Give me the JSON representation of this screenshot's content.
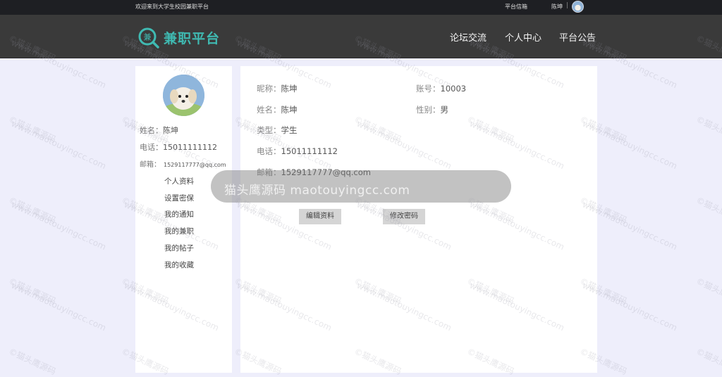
{
  "topbar": {
    "welcome": "欢迎来到大学生校园兼职平台",
    "mail": "平台信箱",
    "username": "陈坤",
    "separator": "|"
  },
  "navbar": {
    "logo_icon_char": "兼",
    "logo_text": "兼职平台",
    "items": [
      "论坛交流",
      "个人中心",
      "平台公告"
    ],
    "brand_color": "#3fbab2"
  },
  "sidebar": {
    "name_label": "姓名：",
    "name": "陈坤",
    "phone_label": "电话：",
    "phone": "15011111112",
    "email_label": "邮箱：",
    "email": "1529117777@qq.com",
    "menu": [
      "个人资料",
      "设置密保",
      "我的通知",
      "我的兼职",
      "我的帖子",
      "我的收藏"
    ]
  },
  "profile": {
    "nickname_label": "昵称：",
    "nickname": "陈坤",
    "account_label": "账号：",
    "account": "10003",
    "name_label": "姓名：",
    "name": "陈坤",
    "gender_label": "性别：",
    "gender": "男",
    "type_label": "类型：",
    "type": "学生",
    "phone_label": "电话：",
    "phone": "15011111112",
    "email_label": "邮箱：",
    "email": "1529117777@qq.com"
  },
  "buttons": {
    "edit": "编辑资料",
    "change_password": "修改密码"
  },
  "watermark": {
    "banner": "猫头鹰源码 maotouyingcc.com",
    "tile_cn": "©猫头鹰源码",
    "tile_en": "www.maotouyingcc.com"
  }
}
